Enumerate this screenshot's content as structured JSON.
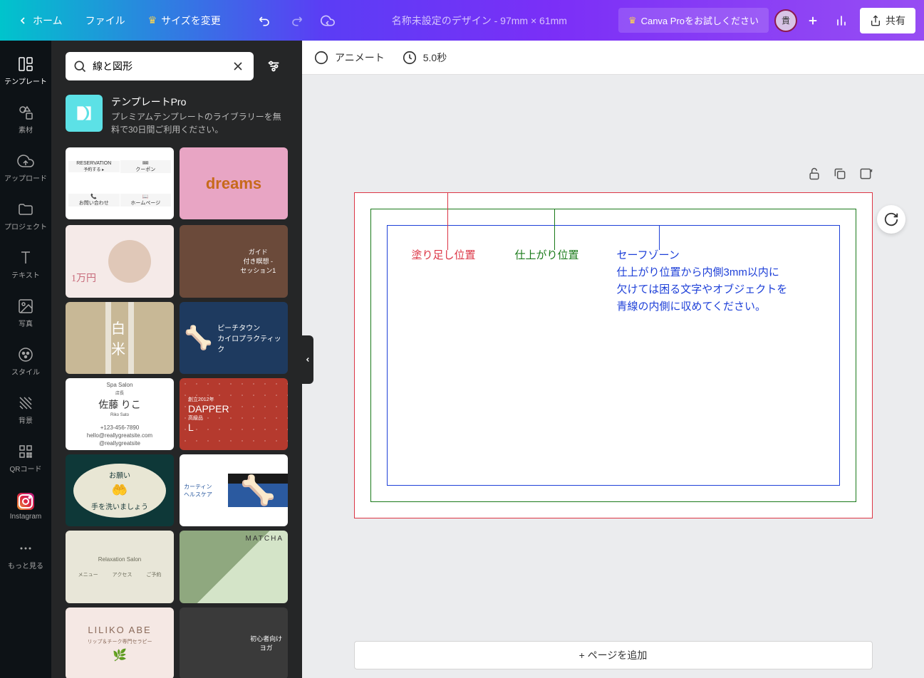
{
  "header": {
    "home": "ホーム",
    "file": "ファイル",
    "resize": "サイズを変更",
    "docTitle": "名称未設定のデザイン - 97mm × 61mm",
    "tryPro": "Canva Proをお試しください",
    "avatarInitial": "貴",
    "share": "共有"
  },
  "sidebar": {
    "items": [
      {
        "label": "テンプレート"
      },
      {
        "label": "素材"
      },
      {
        "label": "アップロード"
      },
      {
        "label": "プロジェクト"
      },
      {
        "label": "テキスト"
      },
      {
        "label": "写真"
      },
      {
        "label": "スタイル"
      },
      {
        "label": "背景"
      },
      {
        "label": "QRコード"
      },
      {
        "label": "Instagram"
      },
      {
        "label": "もっと見る"
      }
    ]
  },
  "panel": {
    "searchValue": "線と図形",
    "promoTitle": "テンプレートPro",
    "promoDesc": "プレミアムテンプレートのライブラリーを無料で30日間ご利用ください。",
    "templates": {
      "t1a": "RESERVATION",
      "t1b": "クーポン",
      "t1c": "お問い合わせ",
      "t1d": "ホームページ",
      "t2": "dreams",
      "t3": "1万円",
      "t4a": "ガイド",
      "t4b": "付き瞑想 -",
      "t4c": "セッション1",
      "t5": "白米",
      "t6a": "ピーチタウン",
      "t6b": "カイロプラクティック",
      "t7a": "Spa Salon",
      "t7b": "店長",
      "t7c": "佐藤 りこ",
      "t7d": "Riko Sato",
      "t7e": "+123-456-7890",
      "t7f": "hello@reallygreatsite.com",
      "t7g": "@reallygreatsite",
      "t8a": "創立2012年",
      "t8b": "DAPPER",
      "t8c": "高級品",
      "t8d": "L",
      "t9a": "お願い",
      "t9b": "手を洗いましょう",
      "t10a": "カーティン",
      "t10b": "ヘルスケア",
      "t11a": "Relaxation Salon",
      "t11b": "メニュー",
      "t11c": "アクセス",
      "t11d": "ご予約",
      "t12": "MATCHA",
      "t13a": "LILIKO ABE",
      "t13b": "リップ＆チーク専門セラピー",
      "t14a": "初心者向け",
      "t14b": "ヨガ"
    }
  },
  "canvasToolbar": {
    "animate": "アニメート",
    "duration": "5.0秒"
  },
  "design": {
    "bleedLabel": "塗り足し位置",
    "trimLabel": "仕上がり位置",
    "safeTitle": "セーフゾーン",
    "safeDesc1": "仕上がり位置から内側3mm以内に",
    "safeDesc2": "欠けては困る文字やオブジェクトを",
    "safeDesc3": "青線の内側に収めてください。"
  },
  "addPage": "+ ページを追加"
}
